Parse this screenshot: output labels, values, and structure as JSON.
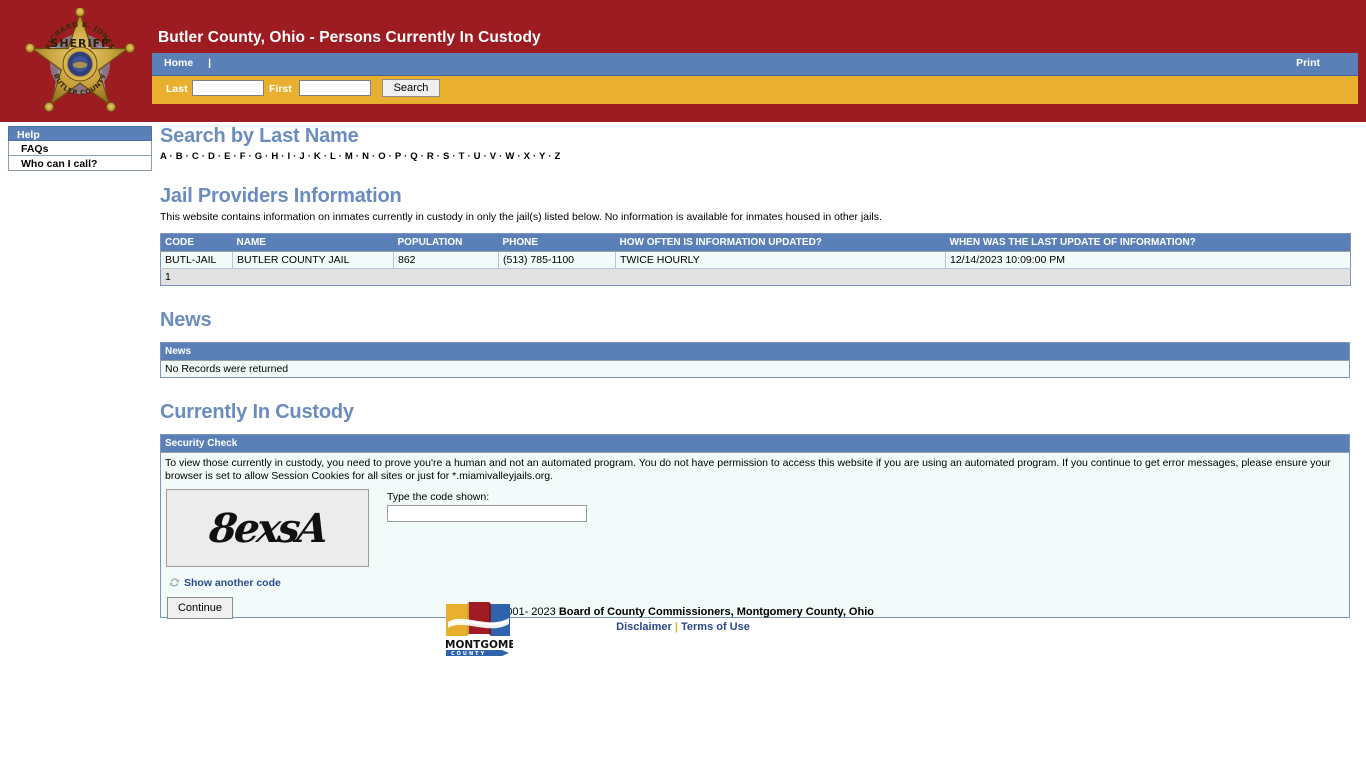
{
  "header": {
    "title": "Butler County, Ohio - Persons Currently In Custody",
    "badge": {
      "top_text": "RICHARD K. JONES",
      "center_text": "SHERIFF",
      "bottom_text": "BUTLER COUNTY"
    },
    "nav": {
      "home_label": "Home",
      "separator": "|",
      "print_label": "Print"
    },
    "search": {
      "last_label": "Last",
      "last_value": "",
      "first_label": "First",
      "first_value": "",
      "button_label": "Search"
    }
  },
  "sidebar": {
    "header_label": "Help",
    "items": [
      {
        "label": "FAQs"
      },
      {
        "label": "Who can I call?"
      }
    ]
  },
  "main": {
    "search_by_last_name": {
      "heading": "Search by Last Name",
      "letters": [
        "A",
        "B",
        "C",
        "D",
        "E",
        "F",
        "G",
        "H",
        "I",
        "J",
        "K",
        "L",
        "M",
        "N",
        "O",
        "P",
        "Q",
        "R",
        "S",
        "T",
        "U",
        "V",
        "W",
        "X",
        "Y",
        "Z"
      ],
      "separator": "·"
    },
    "jail_providers": {
      "heading": "Jail Providers Information",
      "intro": "This website contains information on inmates currently in custody in only the jail(s) listed below. No information is available for inmates housed in other jails.",
      "columns": [
        "CODE",
        "NAME",
        "POPULATION",
        "PHONE",
        "HOW OFTEN IS INFORMATION UPDATED?",
        "WHEN WAS THE LAST UPDATE OF INFORMATION?"
      ],
      "rows": [
        {
          "code": "BUTL-JAIL",
          "name": "BUTLER COUNTY JAIL",
          "population": "862",
          "phone": "(513) 785-1100",
          "how_often": "TWICE HOURLY",
          "last_update": "12/14/2023 10:09:00 PM"
        }
      ],
      "pager": "1"
    },
    "news": {
      "heading": "News",
      "column": "News",
      "empty_message": "No Records were returned"
    },
    "currently_in_custody": {
      "heading": "Currently In Custody",
      "security_check": {
        "panel_title": "Security Check",
        "instructions": "To view those currently in custody, you need to prove you're a human and not an automated program. You do not have permission to access this website if you are using an automated program. If you continue to get error messages, please ensure your browser is set to allow Session Cookies for all sites or just for *.miamivalleyjails.org.",
        "captcha_code": "8exsA",
        "code_label": "Type the code shown:",
        "code_value": "",
        "another_code_label": "Show another code",
        "continue_label": "Continue"
      }
    }
  },
  "footer": {
    "copyright_prefix": "©2001- 2023 ",
    "copyright_org": "Board of County Commissioners, Montgomery County, Ohio",
    "disclaimer_label": "Disclaimer",
    "pipe": "|",
    "terms_label": "Terms of Use",
    "logo": {
      "name_text": "MONTGOMERY",
      "sub_text": "C O U N T Y"
    }
  },
  "colors": {
    "header_red": "#9c1c22",
    "nav_blue": "#5b80b8",
    "search_gold": "#e8b02e",
    "heading_blue": "#6b8cbe",
    "panel_bg": "#f2fbfa",
    "link_blue": "#2b4a8b"
  }
}
